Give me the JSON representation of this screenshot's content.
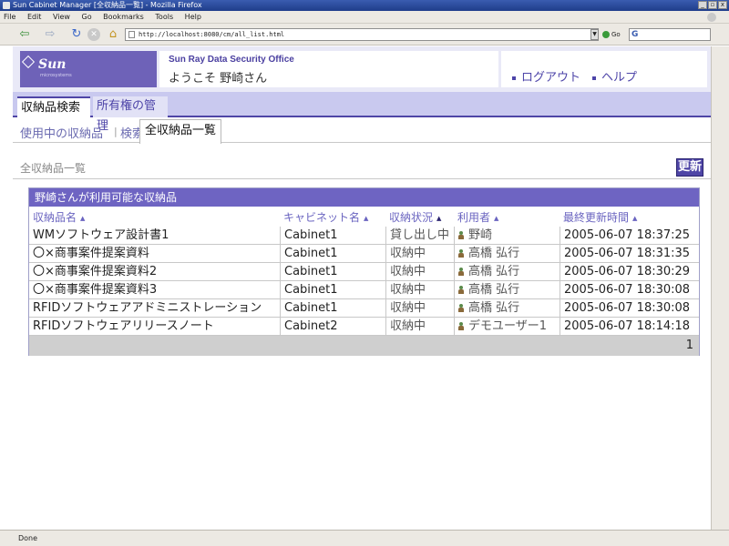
{
  "window": {
    "title": "Sun Cabinet Manager [全収納品一覧] - Mozilla Firefox",
    "controls": [
      "_",
      "▫",
      "x"
    ]
  },
  "menubar": {
    "items": [
      "File",
      "Edit",
      "View",
      "Go",
      "Bookmarks",
      "Tools",
      "Help"
    ]
  },
  "toolbar": {
    "url": "http://localhost:8080/cm/all_list.html",
    "go_label": "Go",
    "search_icon": "G"
  },
  "header": {
    "logo_text": "Sun",
    "logo_sub": "microsystems",
    "product_name": "Sun Ray Data Security Office",
    "welcome": "ようこそ 野崎さん",
    "logout": "ログアウト",
    "help": "ヘルプ"
  },
  "tabs": {
    "primary": [
      "収納品検索",
      "所有権の管理"
    ],
    "secondary": [
      "使用中の収納品",
      "検索",
      "全収納品一覧"
    ],
    "separator": "|"
  },
  "section": {
    "title": "全収納品一覧",
    "refresh": "更新"
  },
  "table": {
    "caption": "野崎さんが利用可能な収納品",
    "sort_arrow": "▲",
    "columns": [
      "収納品名",
      "キャビネット名",
      "収納状況",
      "利用者",
      "最終更新時間"
    ],
    "rows": [
      {
        "name": "WMソフトウェア設計書1",
        "cabinet": "Cabinet1",
        "status": "貸し出し中",
        "user": "野崎",
        "time": "2005-06-07 18:37:25"
      },
      {
        "name": "〇×商事案件提案資料",
        "cabinet": "Cabinet1",
        "status": "収納中",
        "user": "高橋 弘行",
        "time": "2005-06-07 18:31:35"
      },
      {
        "name": "〇×商事案件提案資料2",
        "cabinet": "Cabinet1",
        "status": "収納中",
        "user": "高橋 弘行",
        "time": "2005-06-07 18:30:29"
      },
      {
        "name": "〇×商事案件提案資料3",
        "cabinet": "Cabinet1",
        "status": "収納中",
        "user": "高橋 弘行",
        "time": "2005-06-07 18:30:08"
      },
      {
        "name": "RFIDソフトウェアアドミニストレーション",
        "cabinet": "Cabinet1",
        "status": "収納中",
        "user": "高橋 弘行",
        "time": "2005-06-07 18:30:08"
      },
      {
        "name": "RFIDソフトウェアリリースノート",
        "cabinet": "Cabinet2",
        "status": "収納中",
        "user": "デモユーザー1",
        "time": "2005-06-07 18:14:18"
      }
    ],
    "page": "1"
  },
  "statusbar": {
    "text": "Done"
  },
  "colors": {
    "accent": "#4e45a6",
    "tab_bar": "#c9c9ef",
    "table_caption": "#6e64c2"
  }
}
